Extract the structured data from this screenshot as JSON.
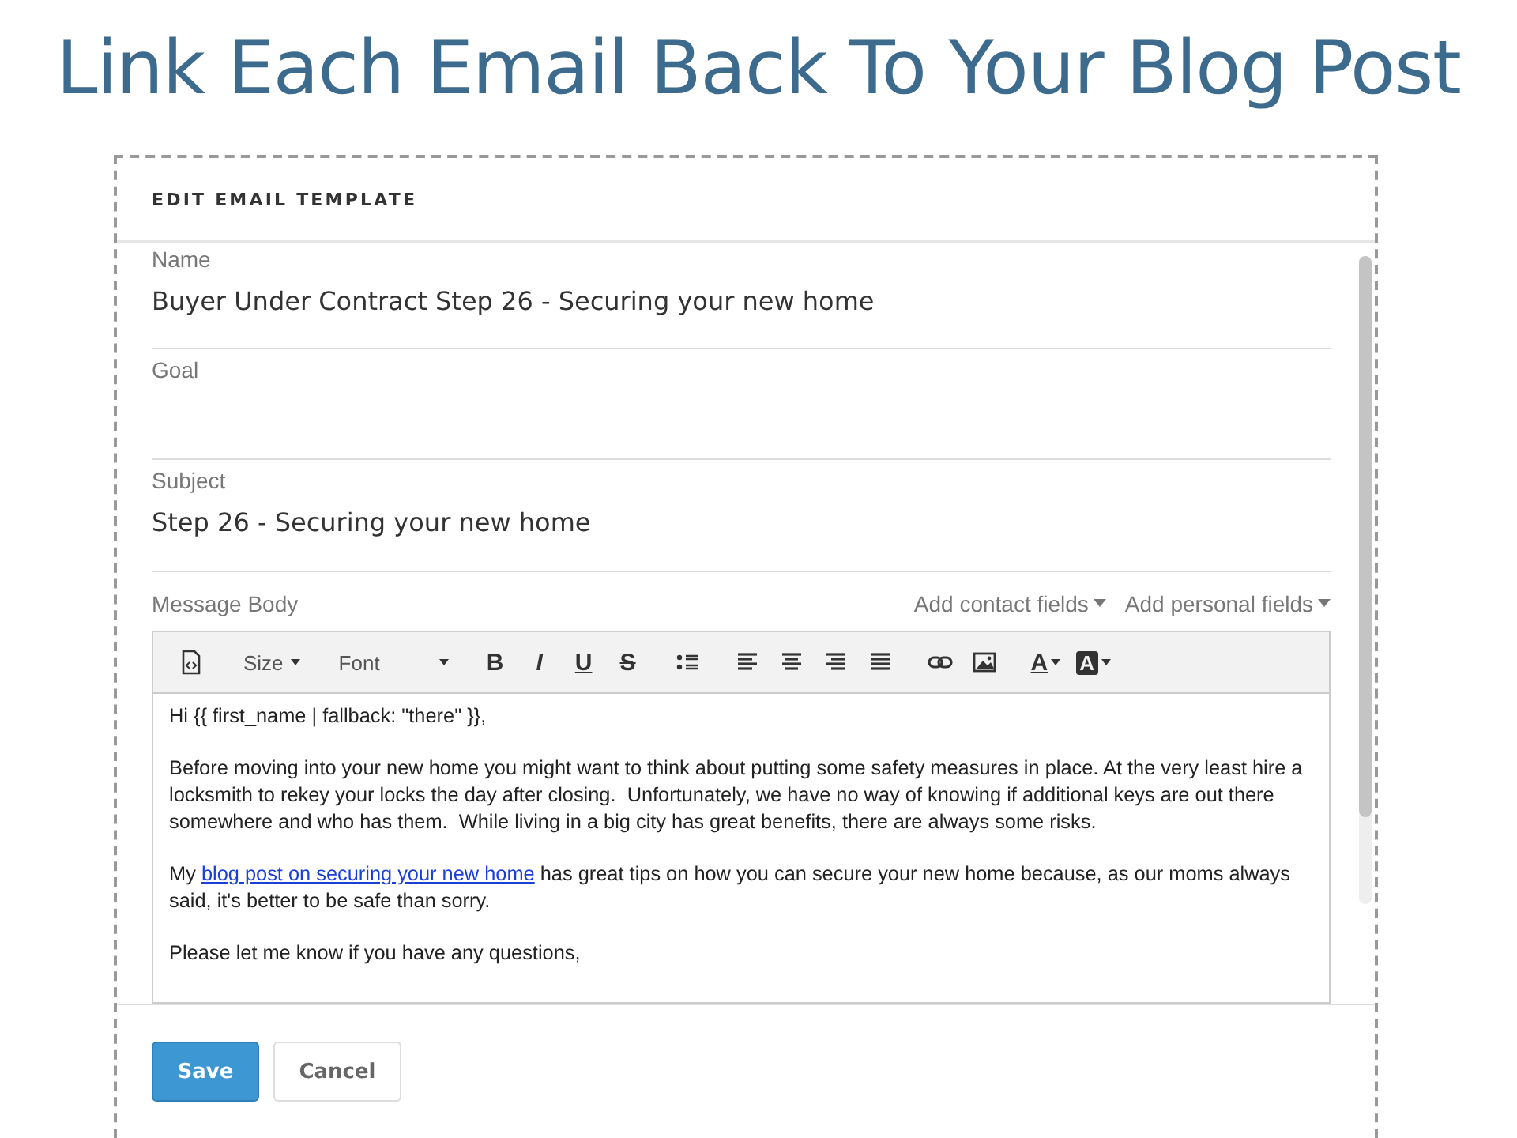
{
  "slide_title": "Link Each Email Back To Your Blog Post",
  "dialog": {
    "title": "EDIT EMAIL TEMPLATE",
    "fields": [
      {
        "label": "Name",
        "value": "Buyer Under Contract Step 26 - Securing your new home"
      },
      {
        "label": "Goal"
      },
      {
        "label": "Subject",
        "value": "Step 26 - Securing your new home"
      }
    ],
    "message_body": {
      "label": "Message Body",
      "menus": [
        "Add contact fields",
        "Add personal fields"
      ],
      "toolbar": {
        "size_label": "Size",
        "font_label": "Font",
        "format_buttons": [
          "B",
          "I",
          "U",
          "S"
        ],
        "color_buttons": [
          "A",
          "A"
        ]
      },
      "paragraphs": [
        [
          {
            "kind": "text",
            "text": "Hi {{ first_name | fallback: \"there\" }},"
          }
        ],
        [
          {
            "kind": "text",
            "text": "Before moving into your new home you might want to think about putting some safety measures in place. At the very least hire a locksmith to rekey your locks the day after closing.  Unfortunately, we have no way of knowing if additional keys are out there somewhere and who has them.  While living in a big city has great benefits, there are always some risks."
          }
        ],
        [
          {
            "kind": "text",
            "text": "My "
          },
          {
            "kind": "link",
            "text": "blog post on securing your new home"
          },
          {
            "kind": "text",
            "text": " has great tips on how you can secure your new home because, as our moms always said, it's better to be safe than sorry."
          }
        ],
        [
          {
            "kind": "text",
            "text": "Please let me know if you have any questions,"
          }
        ]
      ]
    },
    "buttons": [
      {
        "label": "Save",
        "kind": "primary"
      },
      {
        "label": "Cancel",
        "kind": "secondary"
      }
    ]
  }
}
